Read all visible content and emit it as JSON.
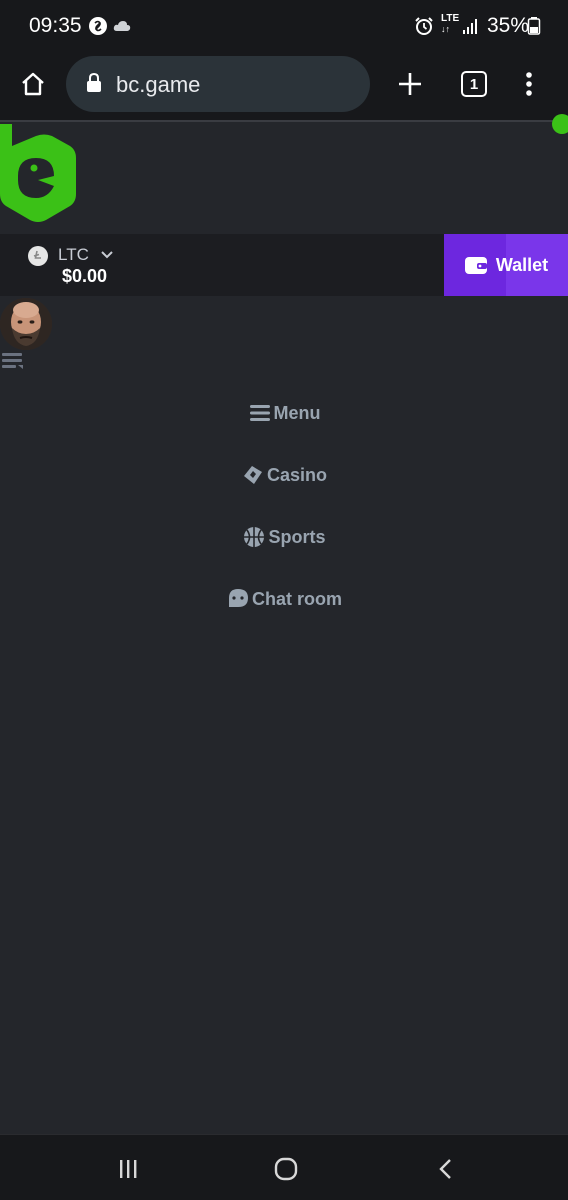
{
  "status_bar": {
    "time": "09:35",
    "lte": "LTE",
    "battery": "35%",
    "icons": [
      "shazam-icon",
      "cloud-icon",
      "alarm-icon",
      "lte-icon",
      "signal-icon",
      "battery-icon"
    ]
  },
  "browser": {
    "url": "bc.game",
    "tab_count": "1",
    "icons": [
      "home-icon",
      "lock-icon",
      "plus-icon",
      "tabs-icon",
      "kebab-menu-icon"
    ]
  },
  "wallet": {
    "currency": "LTC",
    "balance": "$0.00",
    "button_label": "Wallet"
  },
  "nav": {
    "items": [
      {
        "label": "Menu",
        "icon": "menu-lines-icon"
      },
      {
        "label": "Casino",
        "icon": "casino-icon"
      },
      {
        "label": "Sports",
        "icon": "basketball-icon"
      },
      {
        "label": "Chat room",
        "icon": "chat-bubble-icon"
      }
    ]
  },
  "colors": {
    "background": "#24262b",
    "brand_green": "#3bc117",
    "wallet_purple": "#6d27df",
    "nav_text": "#99a4b0"
  }
}
